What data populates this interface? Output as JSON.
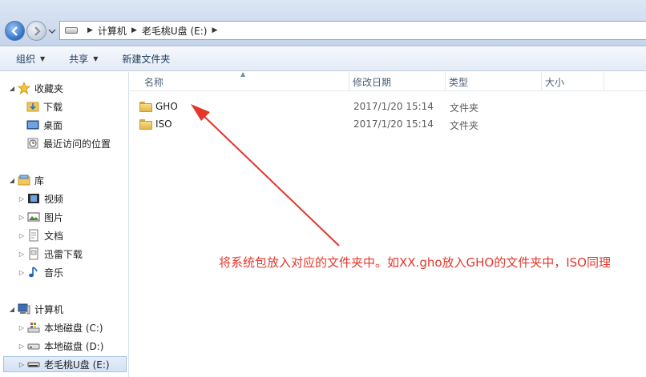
{
  "breadcrumb": [
    "计算机",
    "老毛桃U盘 (E:)"
  ],
  "toolbar": {
    "organize": "组织",
    "share": "共享",
    "new_folder": "新建文件夹"
  },
  "nav": {
    "favorites": {
      "label": "收藏夹",
      "items": [
        "下载",
        "桌面",
        "最近访问的位置"
      ]
    },
    "libraries": {
      "label": "库",
      "items": [
        "视频",
        "图片",
        "文档",
        "迅雷下载",
        "音乐"
      ]
    },
    "computer": {
      "label": "计算机",
      "items": [
        "本地磁盘 (C:)",
        "本地磁盘 (D:)",
        "老毛桃U盘 (E:)"
      ]
    }
  },
  "columns": {
    "name": "名称",
    "date": "修改日期",
    "type": "类型",
    "size": "大小"
  },
  "files": [
    {
      "name": "GHO",
      "date": "2017/1/20 15:14",
      "type": "文件夹",
      "size": ""
    },
    {
      "name": "ISO",
      "date": "2017/1/20 15:14",
      "type": "文件夹",
      "size": ""
    }
  ],
  "annotation": "将系统包放入对应的文件夹中。如XX.gho放入GHO的文件夹中，ISO同理",
  "colors": {
    "annotation": "#e4362b",
    "selection": "#d3e2f5"
  }
}
